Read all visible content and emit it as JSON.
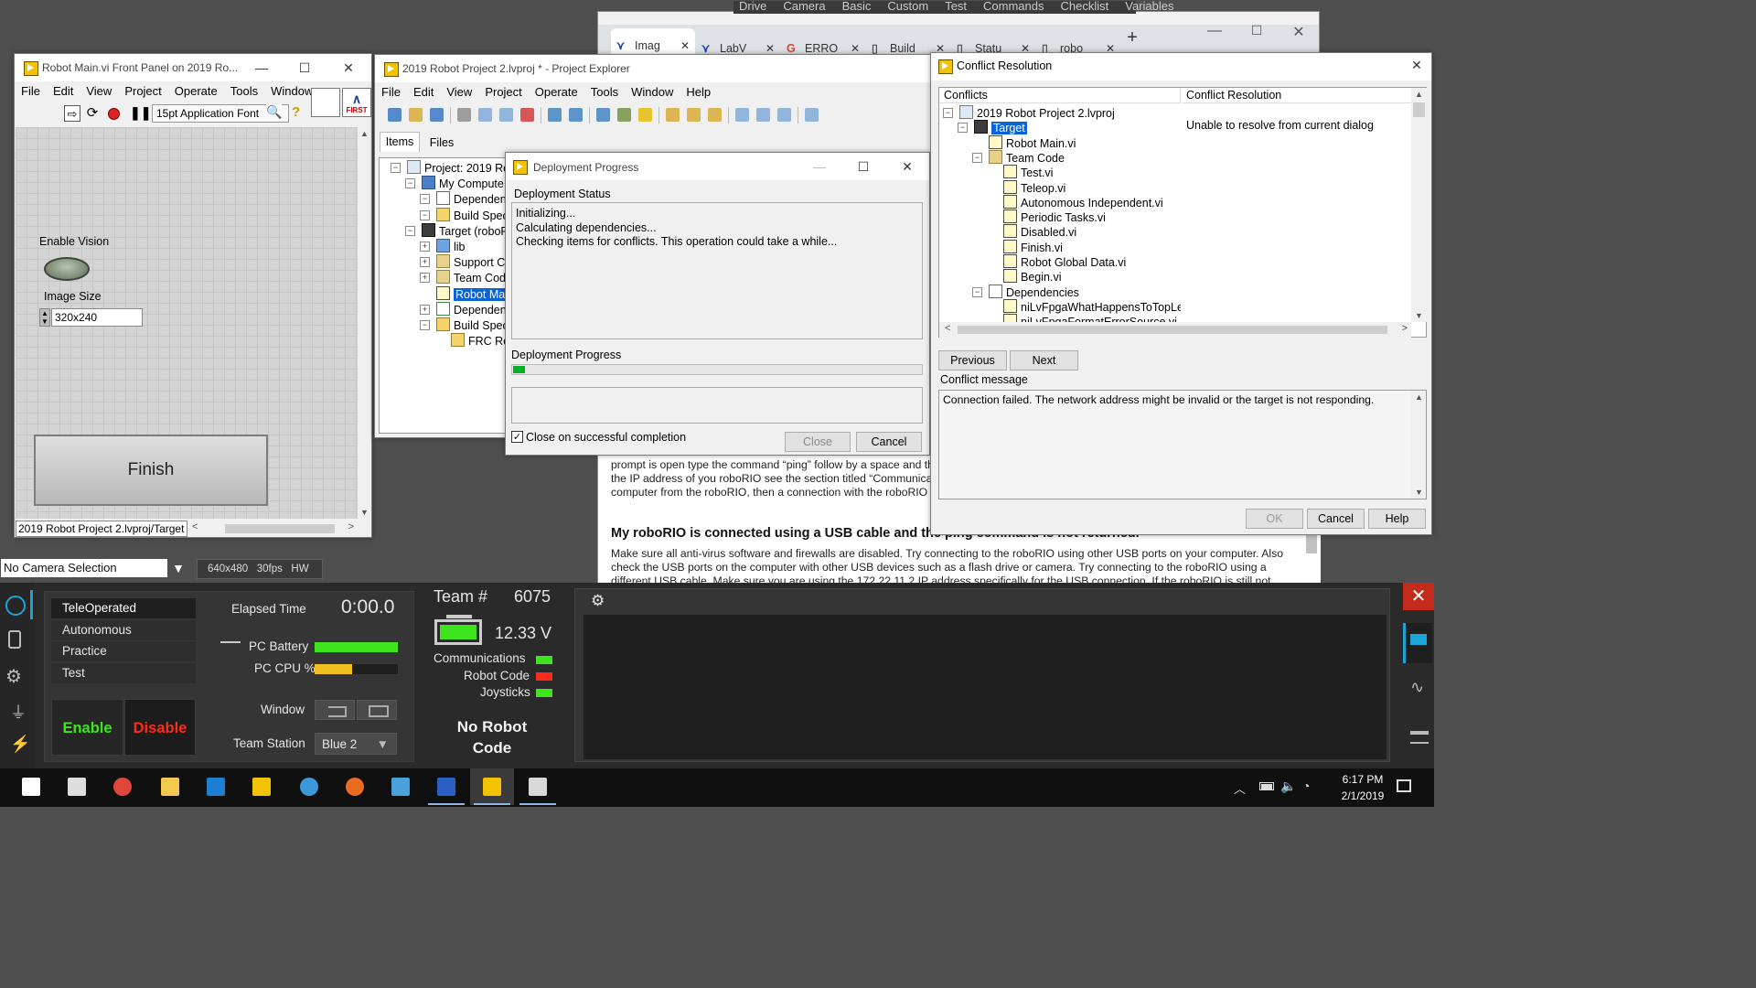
{
  "browser": {
    "top_tabs": [
      "Drive",
      "Camera",
      "Basic",
      "Custom",
      "Test",
      "Commands",
      "Checklist",
      "Variables"
    ],
    "tabs": [
      {
        "label": "Imag",
        "icon": "first-icon"
      },
      {
        "label": "LabV",
        "icon": "first-icon"
      },
      {
        "label": "ERRO",
        "icon": "google-icon"
      },
      {
        "label": "Build",
        "icon": "page-icon"
      },
      {
        "label": "Statu",
        "icon": "page-icon"
      },
      {
        "label": "robo",
        "icon": "page-icon"
      }
    ],
    "new_tab": "+",
    "page_heading": "My roboRIO is connected using a USB cable and the ping command is not returned.",
    "page_text_top": [
      "prompt is open type the command “ping” follow by a space and the",
      "the IP address of you roboRIO see the section titled “Communica",
      "computer from the roboRIO, then a connection with the roboRIO"
    ],
    "page_text_bottom": [
      "Make sure all anti-virus software and firewalls are disabled. Try connecting to the roboRIO using other USB ports on your computer. Also",
      "check the USB ports on the computer with other USB devices such as a flash drive or camera. Try connecting to the roboRIO using a",
      "different USB cable. Make sure you are using the 172.22.11.2 IP address specifically for the USB connection. If the roboRIO is still not"
    ]
  },
  "front_panel": {
    "title": "Robot Main.vi Front Panel on 2019 Ro...",
    "menu": [
      "File",
      "Edit",
      "View",
      "Project",
      "Operate",
      "Tools",
      "Window"
    ],
    "font_select": "15pt Application Font",
    "enable_vision_label": "Enable Vision",
    "image_size_label": "Image Size",
    "image_size_value": "320x240",
    "finish_label": "Finish",
    "path": "2019 Robot Project 2.lvproj/Target"
  },
  "project_explorer": {
    "title": "2019 Robot Project 2.lvproj * - Project Explorer",
    "menu": [
      "File",
      "Edit",
      "View",
      "Project",
      "Operate",
      "Tools",
      "Window",
      "Help"
    ],
    "tabs": [
      "Items",
      "Files"
    ],
    "tree": [
      {
        "label": "Project: 2019 Rob",
        "depth": 0,
        "type": "proj"
      },
      {
        "label": "My Compute",
        "depth": 1,
        "type": "pc"
      },
      {
        "label": "Dependen",
        "depth": 2,
        "type": "dep"
      },
      {
        "label": "Build Spec",
        "depth": 2,
        "type": "build"
      },
      {
        "label": "Target (roboR",
        "depth": 1,
        "type": "target"
      },
      {
        "label": "lib",
        "depth": 2,
        "type": "lib"
      },
      {
        "label": "Support C",
        "depth": 2,
        "type": "fold"
      },
      {
        "label": "Team Cod",
        "depth": 2,
        "type": "fold"
      },
      {
        "label": "Robot Mai",
        "depth": 2,
        "type": "vi",
        "selected": true
      },
      {
        "label": "Dependen",
        "depth": 2,
        "type": "dep"
      },
      {
        "label": "Build Spec",
        "depth": 2,
        "type": "build"
      },
      {
        "label": "FRC Ro",
        "depth": 3,
        "type": "build"
      }
    ]
  },
  "deployment": {
    "title": "Deployment Progress",
    "status_label": "Deployment Status",
    "status_lines": [
      "Initializing...",
      "Calculating dependencies...",
      "Checking items for conflicts. This operation could take a while..."
    ],
    "progress_label": "Deployment Progress",
    "progress_fraction": 0.03,
    "close_on_completion": "Close on successful completion",
    "close_checked": true,
    "close_btn": "Close",
    "cancel_btn": "Cancel"
  },
  "conflict": {
    "title": "Conflict Resolution",
    "col_conflicts": "Conflicts",
    "col_resolution": "Conflict Resolution",
    "resolution_text": "Unable to resolve from current dialog",
    "tree": [
      {
        "label": "2019 Robot Project 2.lvproj",
        "depth": 0,
        "type": "proj"
      },
      {
        "label": "Target",
        "depth": 1,
        "type": "target",
        "selected": true
      },
      {
        "label": "Robot Main.vi",
        "depth": 2,
        "type": "vi"
      },
      {
        "label": "Team Code",
        "depth": 2,
        "type": "fold"
      },
      {
        "label": "Test.vi",
        "depth": 3,
        "type": "vi"
      },
      {
        "label": "Teleop.vi",
        "depth": 3,
        "type": "vi"
      },
      {
        "label": "Autonomous Independent.vi",
        "depth": 3,
        "type": "vi"
      },
      {
        "label": "Periodic Tasks.vi",
        "depth": 3,
        "type": "vi"
      },
      {
        "label": "Disabled.vi",
        "depth": 3,
        "type": "vi"
      },
      {
        "label": "Finish.vi",
        "depth": 3,
        "type": "vi"
      },
      {
        "label": "Robot Global Data.vi",
        "depth": 3,
        "type": "vi"
      },
      {
        "label": "Begin.vi",
        "depth": 3,
        "type": "vi"
      },
      {
        "label": "Dependencies",
        "depth": 2,
        "type": "dep"
      },
      {
        "label": "niLvFpgaWhatHappensToTopLe",
        "depth": 3,
        "type": "vi"
      },
      {
        "label": "niLvFpgaFormatErrorSource.vi",
        "depth": 3,
        "type": "vi"
      }
    ],
    "previous_btn": "Previous",
    "next_btn": "Next",
    "message_label": "Conflict message",
    "message": "Connection failed.  The network address might be invalid or the target is not responding.",
    "ok_btn": "OK",
    "cancel_btn": "Cancel",
    "help_btn": "Help"
  },
  "camera_bar": {
    "selection": "No Camera Selection",
    "info": "640x480   30fps   HW"
  },
  "driver_station": {
    "modes": [
      "TeleOperated",
      "Autonomous",
      "Practice",
      "Test"
    ],
    "enable": "Enable",
    "disable": "Disable",
    "elapsed_label": "Elapsed Time",
    "elapsed_value": "0:00.0",
    "pc_battery_label": "PC Battery",
    "pc_battery_level": 1.0,
    "pc_cpu_label": "PC CPU %",
    "pc_cpu_level": 0.45,
    "window_label": "Window",
    "team_station_label": "Team Station",
    "team_station_value": "Blue 2",
    "team_label": "Team #",
    "team_number": "6075",
    "voltage": "12.33 V",
    "communications": "Communications",
    "robot_code": "Robot Code",
    "joysticks": "Joysticks",
    "no_robot_code": "No Robot Code",
    "colors": {
      "green": "#3ee51e",
      "red": "#ff2a1a",
      "yellow": "#f0c020",
      "blue": "#1ba4d8"
    }
  },
  "taskbar": {
    "time": "6:17 PM",
    "date": "2/1/2019",
    "apps": [
      "start-icon",
      "task-view-icon",
      "chrome-icon",
      "file-explorer-icon",
      "maps-icon",
      "labview-project-icon",
      "ie-icon",
      "ni-icon",
      "dashboard-icon",
      "first-icon",
      "labview-icon",
      "driver-station-icon"
    ]
  }
}
